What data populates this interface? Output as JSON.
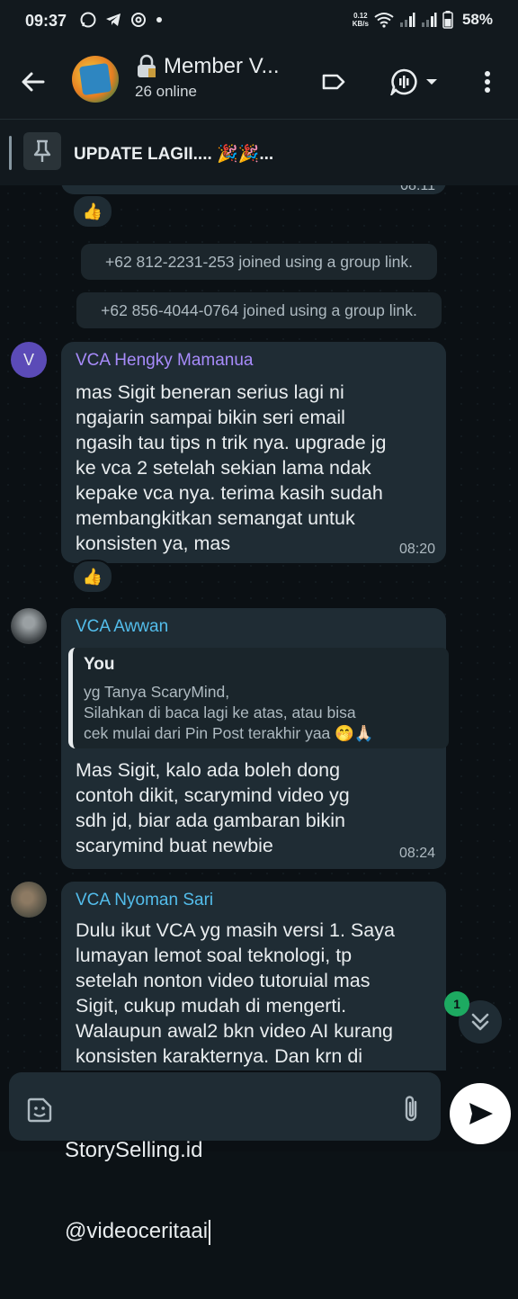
{
  "status_bar": {
    "time": "09:37",
    "net_speed_value": "0.12",
    "net_speed_unit": "KB/s",
    "battery": "58%"
  },
  "header": {
    "title": "Member V...",
    "subtitle": "26 online"
  },
  "pinned": {
    "text": "UPDATE LAGII.... 🎉🎉..."
  },
  "messages": {
    "top_time_partial": "08:11",
    "reaction_1": "👍",
    "system_1": "+62 812-2231-253 joined using a group link.",
    "system_2": "+62 856-4044-0764 joined using a group link.",
    "msg1": {
      "avatar_letter": "V",
      "sender": "VCA Hengky Mamanua",
      "sender_color": "#a78bfa",
      "lines": [
        "mas Sigit beneran serius lagi ni",
        "ngajarin sampai bikin seri email",
        "ngasih tau tips n trik nya. upgrade jg",
        "ke vca 2 setelah sekian lama ndak",
        "kepake vca nya. terima kasih sudah",
        "membangkitkan semangat untuk",
        "konsisten ya, mas"
      ],
      "time": "08:20",
      "reaction": "👍"
    },
    "msg2": {
      "sender": "VCA Awwan",
      "sender_color": "#53bdeb",
      "quote_author": "You",
      "quote_lines": [
        "yg Tanya ScaryMind,",
        "Silahkan di baca lagi ke atas, atau bisa",
        "cek mulai dari Pin Post terakhir yaa 🤭🙏🏻"
      ],
      "lines": [
        "Mas Sigit, kalo ada boleh dong",
        "contoh dikit, scarymind video yg",
        "sdh jd, biar ada gambaran bikin",
        "scarymind buat newbie"
      ],
      "time": "08:24"
    },
    "msg3": {
      "sender": "VCA Nyoman Sari",
      "sender_color": "#53bdeb",
      "lines": [
        "Dulu ikut VCA yg masih versi 1. Saya",
        "lumayan lemot soal teknologi, tp",
        "setelah nonton video tutoruial mas",
        "Sigit, cukup mudah di mengerti.",
        "Walaupun awal2 bkn video AI kurang",
        "konsisten karakternya. Dan krn di"
      ]
    },
    "unread_count": "1"
  },
  "input": {
    "line1": "StorySelling.id",
    "line2": "@videoceritaai"
  },
  "colors": {
    "accent_green": "#1daa61",
    "bubble": "#1f2c34",
    "header_bg": "#12191e"
  }
}
